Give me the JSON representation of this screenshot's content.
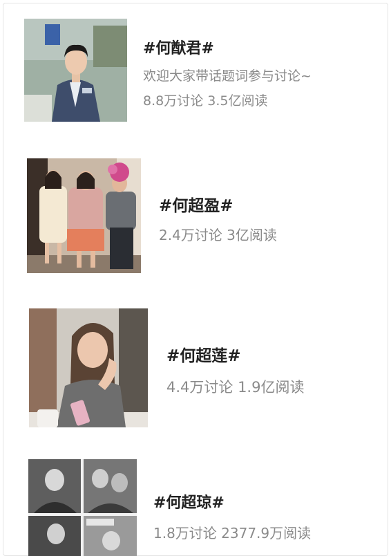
{
  "topics": [
    {
      "title": "#何猷君#",
      "description": "欢迎大家带话题词参与讨论~",
      "stats": "8.8万讨论 3.5亿阅读",
      "thumbnail": "photo-man-in-suit"
    },
    {
      "title": "#何超盈#",
      "stats": "2.4万讨论 3亿阅读",
      "thumbnail": "photo-three-women"
    },
    {
      "title": "#何超莲#",
      "stats": "4.4万讨论 1.9亿阅读",
      "thumbnail": "photo-woman-at-table"
    },
    {
      "title": "#何超琼#",
      "stats": "1.8万讨论 2377.9万阅读",
      "thumbnail": "photo-collage-black-white"
    }
  ]
}
